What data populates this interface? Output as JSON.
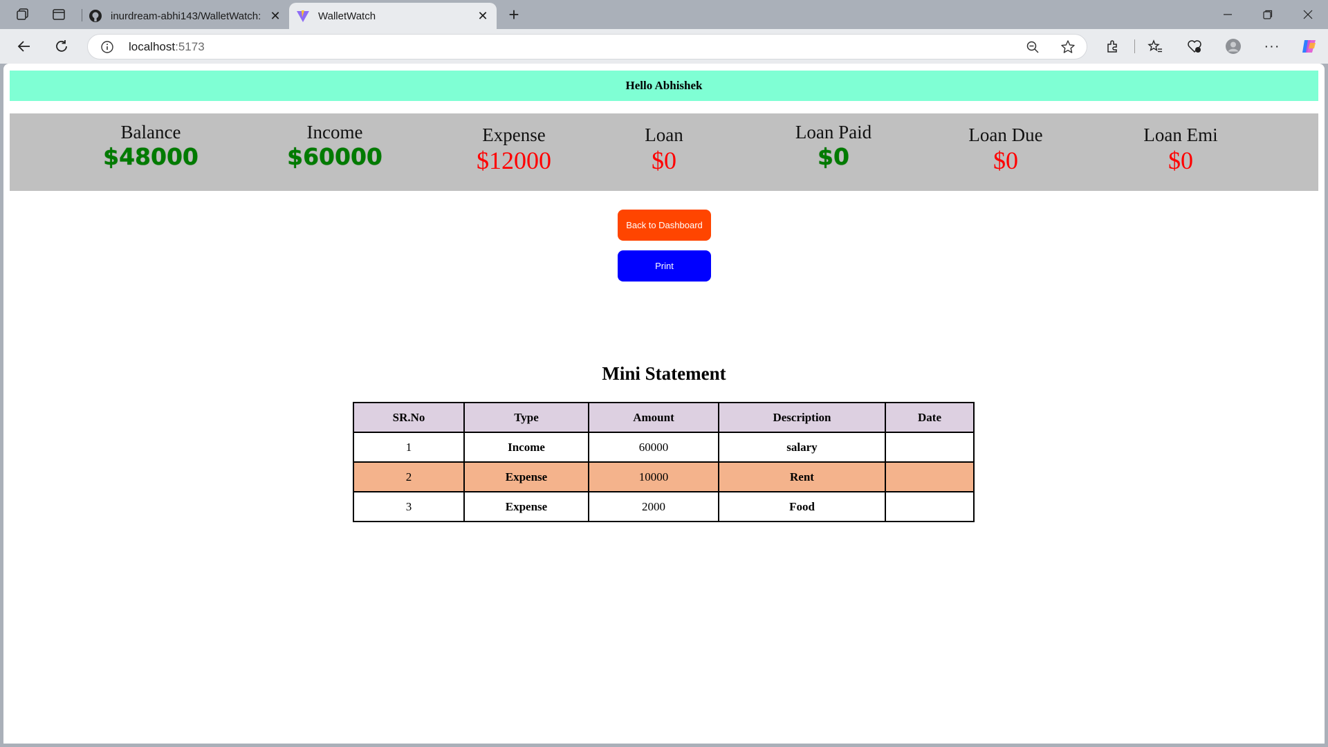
{
  "browser": {
    "tabs": [
      {
        "title": "inurdream-abhi143/WalletWatch:",
        "active": false,
        "favicon": "github-icon"
      },
      {
        "title": "WalletWatch",
        "active": true,
        "favicon": "vite-icon"
      }
    ],
    "url_host": "localhost",
    "url_port": ":5173"
  },
  "greeting": "Hello Abhishek",
  "summary": [
    {
      "label": "Balance",
      "value": "$48000",
      "color": "#007b00"
    },
    {
      "label": "Income",
      "value": "$60000",
      "color": "#007b00"
    },
    {
      "label": "Expense",
      "value": "$12000",
      "color": "#ff0000"
    },
    {
      "label": "Loan",
      "value": "$0",
      "color": "#ff0000"
    },
    {
      "label": "Loan Paid",
      "value": "$0",
      "color": "#007b00"
    },
    {
      "label": "Loan Due",
      "value": "$0",
      "color": "#ff0000"
    },
    {
      "label": "Loan Emi",
      "value": "$0",
      "color": "#ff0000"
    }
  ],
  "buttons": {
    "back": "Back to Dashboard",
    "print": "Print"
  },
  "statement": {
    "title": "Mini Statement",
    "columns": [
      "SR.No",
      "Type",
      "Amount",
      "Description",
      "Date"
    ],
    "rows": [
      {
        "sr": "1",
        "type": "Income",
        "amount": "60000",
        "description": "salary",
        "date": ""
      },
      {
        "sr": "2",
        "type": "Expense",
        "amount": "10000",
        "description": "Rent",
        "date": ""
      },
      {
        "sr": "3",
        "type": "Expense",
        "amount": "2000",
        "description": "Food",
        "date": ""
      }
    ]
  },
  "colors": {
    "greeting_bg": "#7fffd4",
    "summary_bg": "#c0c0c0",
    "back_button": "#ff4500",
    "print_button": "#0000ff",
    "header_row": "#ddd0e1",
    "highlight_row": "#f4b38c"
  }
}
